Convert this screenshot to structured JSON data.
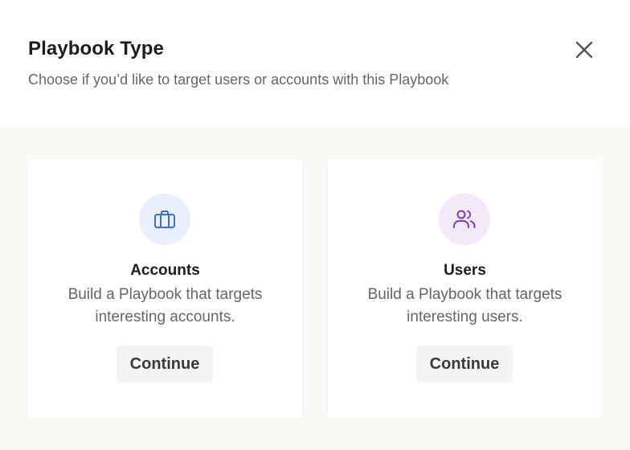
{
  "dialog": {
    "title": "Playbook Type",
    "subtitle": "Choose if you’d like to target users or accounts with this Playbook",
    "close_icon": "close-icon"
  },
  "options": [
    {
      "title": "Accounts",
      "description": "Build a Playbook that targets interesting accounts.",
      "button_label": "Continue",
      "icon": "briefcase-icon",
      "icon_color": "#3b6fd8",
      "icon_bg": "#eaf0fb"
    },
    {
      "title": "Users",
      "description": "Build a Playbook that targets interesting users.",
      "button_label": "Continue",
      "icon": "users-icon",
      "icon_color": "#7a3fc0",
      "icon_bg": "#f2eaf9"
    }
  ],
  "colors": {
    "panel_bg": "#faf9f5",
    "title": "#1e1e1e",
    "muted_text": "#66666a"
  }
}
